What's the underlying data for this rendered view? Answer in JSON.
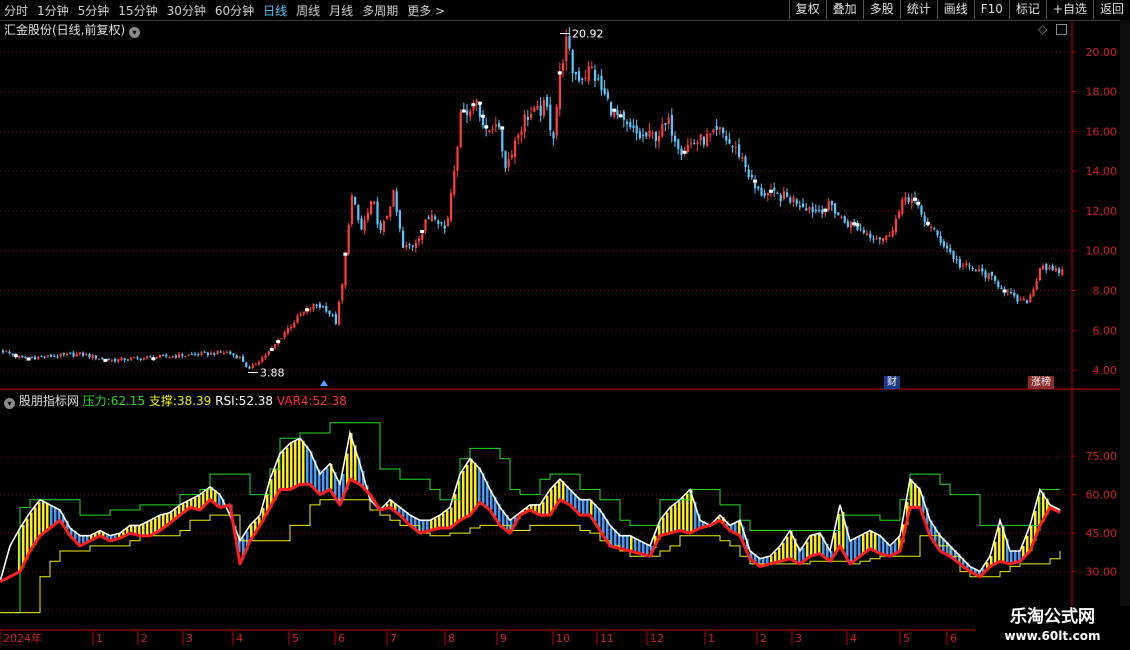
{
  "toolbar": {
    "periods": [
      "分时",
      "1分钟",
      "5分钟",
      "15分钟",
      "30分钟",
      "60分钟",
      "日线",
      "周线",
      "月线",
      "多周期",
      "更多 >"
    ],
    "active_period": "日线",
    "tools": [
      "复权",
      "叠加",
      "多股",
      "统计",
      "画线",
      "F10",
      "标记",
      "+自选",
      "返回"
    ]
  },
  "main_panel": {
    "title": "汇金股份(日线,前复权)",
    "high_label": "20.92",
    "low_label": "3.88",
    "badge_cai": "财",
    "badge_zhangbang": "涨榜"
  },
  "indicator_panel": {
    "name": "股朋指标网",
    "pressure_label": "压力:",
    "pressure_value": "62.15",
    "support_label": "支撑:",
    "support_value": "38.39",
    "rsi_label": "RSI:",
    "rsi_value": "52.38",
    "var4_label": "VAR4:",
    "var4_value": "52.38"
  },
  "x_axis": {
    "year_label": "2024年",
    "months": [
      "1",
      "2",
      "3",
      "4",
      "5",
      "6",
      "7",
      "8",
      "9",
      "10",
      "11",
      "12",
      "1",
      "2",
      "3",
      "4",
      "5",
      "6"
    ]
  },
  "watermark": {
    "title": "乐淘公式网",
    "url": "www.60lt.com"
  },
  "colors": {
    "up": "#ff3c3c",
    "down": "#55c8ff",
    "ma": "#ffffff",
    "rsi": "#ff1e1e",
    "pressure": "#22dd22",
    "support": "#f0f000",
    "axis": "#c00000"
  },
  "chart_data": [
    {
      "type": "line",
      "name": "price",
      "ylim": [
        3.2,
        21.5
      ],
      "yticks": [
        4.0,
        6.0,
        8.0,
        10.0,
        12.0,
        14.0,
        16.0,
        18.0,
        20.0
      ],
      "x": [
        0,
        20,
        50,
        80,
        110,
        140,
        170,
        200,
        225,
        240,
        248,
        258,
        270,
        285,
        300,
        315,
        325,
        335,
        342,
        350,
        360,
        372,
        380,
        392,
        402,
        412,
        420,
        432,
        445,
        455,
        462,
        468,
        475,
        485,
        495,
        505,
        512,
        525,
        535,
        545,
        552,
        560,
        565,
        572,
        580,
        590,
        600,
        612,
        625,
        640,
        655,
        668,
        680,
        695,
        710,
        720,
        728,
        740,
        755,
        770,
        785,
        800,
        815,
        830,
        842,
        855,
        870,
        885,
        898,
        905,
        912,
        920,
        932,
        945,
        958,
        970,
        985,
        1000,
        1015,
        1025,
        1032,
        1040,
        1050,
        1062
      ],
      "values": [
        5.0,
        4.6,
        4.7,
        4.8,
        4.5,
        4.6,
        4.7,
        4.8,
        4.9,
        4.6,
        4.0,
        4.5,
        5.0,
        6.0,
        6.8,
        7.3,
        7.1,
        6.4,
        8.5,
        12.8,
        11.0,
        12.5,
        10.8,
        12.9,
        10.1,
        10.3,
        11.0,
        12.0,
        11.0,
        15.0,
        17.5,
        16.8,
        17.8,
        15.8,
        16.6,
        14.2,
        15.3,
        16.8,
        16.9,
        17.3,
        15.7,
        19.3,
        20.5,
        19.0,
        18.7,
        19.2,
        18.1,
        17.0,
        16.2,
        15.7,
        15.8,
        16.4,
        15.1,
        15.5,
        15.7,
        16.0,
        15.4,
        14.8,
        13.0,
        12.8,
        12.7,
        12.4,
        12.0,
        12.3,
        11.5,
        11.2,
        10.8,
        10.6,
        11.9,
        12.8,
        12.5,
        11.8,
        11.0,
        10.2,
        9.3,
        9.1,
        8.8,
        8.2,
        7.5,
        7.4,
        8.0,
        9.4,
        8.9,
        9.0
      ]
    },
    {
      "type": "line",
      "name": "indicator",
      "ylim": [
        8,
        100
      ],
      "yticks": [
        15.0,
        30.0,
        45.0,
        60.0,
        75.0
      ],
      "x": [
        0,
        10,
        20,
        30,
        40,
        50,
        60,
        70,
        80,
        90,
        100,
        110,
        120,
        130,
        140,
        150,
        160,
        170,
        180,
        190,
        200,
        210,
        220,
        230,
        240,
        250,
        260,
        270,
        280,
        290,
        300,
        310,
        320,
        330,
        340,
        350,
        360,
        370,
        380,
        390,
        400,
        410,
        420,
        430,
        440,
        450,
        460,
        470,
        480,
        490,
        500,
        510,
        520,
        530,
        540,
        550,
        560,
        570,
        580,
        590,
        600,
        610,
        620,
        630,
        640,
        650,
        660,
        670,
        680,
        690,
        700,
        710,
        720,
        730,
        740,
        750,
        760,
        770,
        780,
        790,
        800,
        810,
        820,
        830,
        840,
        850,
        860,
        870,
        880,
        890,
        900,
        910,
        920,
        930,
        940,
        950,
        960,
        970,
        980,
        990,
        1000,
        1010,
        1020,
        1030,
        1040,
        1050,
        1060
      ],
      "rsi": [
        26,
        28,
        30,
        38,
        44,
        47,
        50,
        44,
        40,
        42,
        44,
        42,
        43,
        45,
        44,
        44,
        46,
        49,
        52,
        55,
        54,
        58,
        55,
        56,
        33,
        42,
        48,
        55,
        62,
        62,
        64,
        64,
        60,
        62,
        56,
        66,
        64,
        60,
        54,
        55,
        52,
        48,
        45,
        46,
        47,
        47,
        50,
        52,
        57,
        54,
        48,
        45,
        52,
        54,
        52,
        52,
        58,
        56,
        52,
        52,
        46,
        40,
        39,
        38,
        37,
        36,
        44,
        45,
        46,
        45,
        47,
        48,
        50,
        46,
        44,
        35,
        32,
        33,
        34,
        35,
        33,
        36,
        37,
        34,
        40,
        33,
        36,
        39,
        37,
        36,
        38,
        55,
        55,
        44,
        38,
        36,
        33,
        30,
        28,
        32,
        34,
        33,
        34,
        38,
        48,
        55,
        53
      ],
      "white": [
        26,
        40,
        47,
        53,
        58,
        56,
        54,
        47,
        44,
        44,
        46,
        44,
        45,
        48,
        48,
        50,
        52,
        53,
        56,
        58,
        60,
        63,
        60,
        52,
        42,
        48,
        52,
        66,
        76,
        80,
        82,
        77,
        68,
        72,
        64,
        84,
        72,
        58,
        54,
        58,
        55,
        52,
        50,
        50,
        52,
        55,
        68,
        74,
        70,
        62,
        55,
        50,
        53,
        56,
        56,
        62,
        66,
        62,
        58,
        58,
        54,
        48,
        44,
        44,
        42,
        40,
        50,
        55,
        58,
        62,
        50,
        48,
        52,
        48,
        50,
        38,
        35,
        36,
        40,
        46,
        38,
        44,
        45,
        38,
        56,
        42,
        44,
        46,
        44,
        40,
        44,
        66,
        62,
        50,
        44,
        40,
        36,
        32,
        30,
        36,
        50,
        38,
        38,
        48,
        62,
        56,
        54
      ],
      "pressure": [
        14,
        14,
        55,
        58,
        58,
        58,
        58,
        58,
        52,
        52,
        52,
        54,
        54,
        54,
        56,
        56,
        56,
        56,
        60,
        60,
        62,
        68,
        68,
        68,
        68,
        60,
        60,
        70,
        82,
        82,
        84,
        84,
        84,
        88,
        88,
        88,
        88,
        88,
        70,
        70,
        66,
        66,
        66,
        62,
        58,
        58,
        74,
        78,
        78,
        78,
        74,
        62,
        60,
        60,
        66,
        68,
        68,
        68,
        62,
        62,
        58,
        58,
        50,
        48,
        48,
        48,
        58,
        58,
        58,
        62,
        62,
        62,
        56,
        56,
        50,
        46,
        46,
        46,
        46,
        46,
        46,
        46,
        46,
        46,
        52,
        52,
        52,
        52,
        50,
        50,
        58,
        68,
        68,
        68,
        64,
        60,
        60,
        60,
        48,
        48,
        48,
        48,
        48,
        48,
        62,
        62,
        62
      ],
      "support": [
        14,
        14,
        14,
        14,
        28,
        34,
        38,
        38,
        38,
        40,
        40,
        40,
        40,
        42,
        44,
        44,
        44,
        44,
        46,
        50,
        50,
        52,
        52,
        52,
        42,
        42,
        42,
        42,
        42,
        48,
        48,
        56,
        58,
        58,
        58,
        58,
        58,
        54,
        52,
        50,
        48,
        48,
        45,
        44,
        44,
        45,
        45,
        47,
        48,
        48,
        48,
        46,
        46,
        48,
        48,
        48,
        48,
        48,
        46,
        45,
        42,
        40,
        38,
        36,
        36,
        36,
        38,
        40,
        44,
        44,
        44,
        44,
        42,
        40,
        36,
        33,
        33,
        33,
        33,
        33,
        33,
        34,
        34,
        34,
        34,
        33,
        34,
        35,
        36,
        36,
        36,
        36,
        44,
        44,
        40,
        36,
        30,
        28,
        28,
        28,
        30,
        32,
        33,
        33,
        33,
        35,
        38
      ]
    }
  ]
}
